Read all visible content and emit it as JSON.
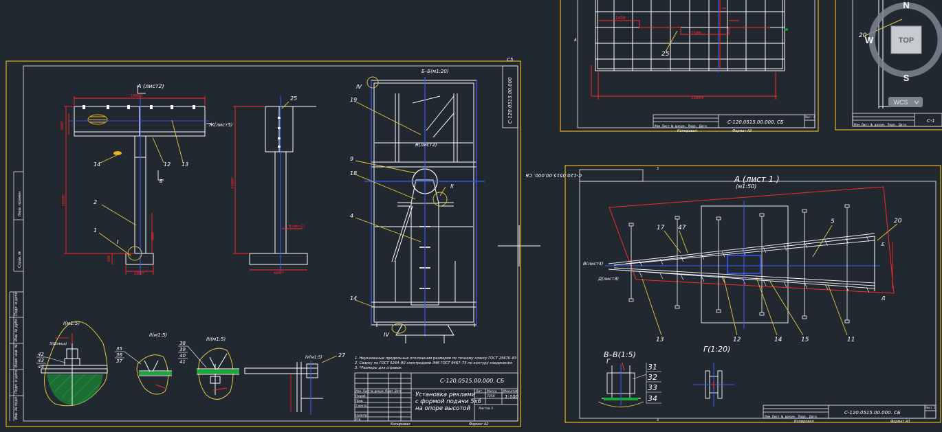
{
  "colors": {
    "background": "#212830",
    "frame": "#e6b422",
    "inner_frame": "#f2f2f2",
    "structure": "#ffffff",
    "axis": "#3a5bff",
    "dimension": "#ff2a2a",
    "leader": "#e6c84a",
    "hatch": "#1aa83a",
    "text": "#ffffff"
  },
  "main_sheet": {
    "sheet_number": "С5",
    "side_code": "С-120.0515.00.000",
    "view_a_label": "А (лист2)",
    "view_b_label": "Б–Б(м1:20)",
    "view_zh_label": "Ж(лист5)",
    "view_v_label": "В(лист2)",
    "arrow_b": "Б",
    "callouts": [
      "14",
      "12",
      "13",
      "2",
      "1",
      "I",
      "25",
      "19",
      "9",
      "18",
      "4",
      "14",
      "II",
      "IV"
    ],
    "detail_labels": {
      "d1": "I(м1:5)",
      "d2": "II(м1:5)",
      "d3": "III(м1:5)",
      "d4": "IV(м1:5)"
    },
    "detail1_items": [
      "42",
      "43",
      "44"
    ],
    "detail2_items": [
      "35",
      "36",
      "37"
    ],
    "detail3_items": [
      "38",
      "39",
      "40",
      "41"
    ],
    "detail4_item": "27",
    "notes": [
      "1. Неуказанные предельные отклонения размеров по точному классу ГОСТ 25670–83",
      "2. Сварку по ГОСТ 5264–80 электродами Э46 ГОСТ 9467–75 по контуру соединения",
      "3. *Размеры для справок"
    ],
    "title_block": {
      "code": "С-120.0515.00.000. СБ",
      "name_lines": [
        "Установка реклами",
        "с формой подачи 5х6",
        "на опоре высотой"
      ],
      "header": [
        "Лит.",
        "Масса",
        "Масштаб"
      ],
      "scale": "1:100",
      "mass": "7250",
      "sheet": "Листов 5",
      "roles": [
        "Изм. Лист  № докум.  Подп.  Дата",
        "Разраб.",
        "Пров.",
        "Т.контр.",
        "Н.контр.",
        "Утв."
      ],
      "copied": "Копировал",
      "format": "Формат А2"
    },
    "side_stamps": [
      "Перв. примен.",
      "Справ. №",
      "Подп. и дата",
      "Инв. № дубл.",
      "Взам. инв. №",
      "Подп. и дата",
      "Инв. № подл."
    ]
  },
  "top_sheet": {
    "code": "С-120.0515.00.000. СБ",
    "sheet": "Лист 4",
    "callout": "25",
    "stamp_text": "Изм Лист  № докум. Подп. Дата",
    "copied": "Копировал",
    "format": "Формат А3",
    "side_mark": "А"
  },
  "right_sheet": {
    "code": "С-120.0515.00.000. СБ",
    "rotated_code": "С-120.0515.00.000. СБ",
    "view_label": "А (лист 1.)",
    "view_scale": "(м1:50)",
    "detail_vv": "В–В(1:5)",
    "detail_g": "Г(1:20)",
    "arrow_g": "Г",
    "callouts": [
      "17",
      "47",
      "5",
      "20",
      "13",
      "12",
      "14",
      "15",
      "11"
    ],
    "label_v": "В(лист4)",
    "label_d": "Д(лист3)",
    "label_e": "Е",
    "label_d2": "Д",
    "detail_items": [
      "31",
      "32",
      "33",
      "34"
    ],
    "sheet": "Лист 2",
    "copied": "Копировал",
    "format": "Формат А3",
    "stamp_text": "Изм Лист  № докум. Подп. Дата",
    "zone_mark": "3"
  },
  "far_sheet": {
    "callout": "20",
    "stamp_text": "Изм Лист  № докум. Подп. Дата",
    "code": "С-1"
  },
  "viewcube": {
    "north": "N",
    "south": "S",
    "west": "W",
    "face": "TOP",
    "wcs": "WCS"
  }
}
